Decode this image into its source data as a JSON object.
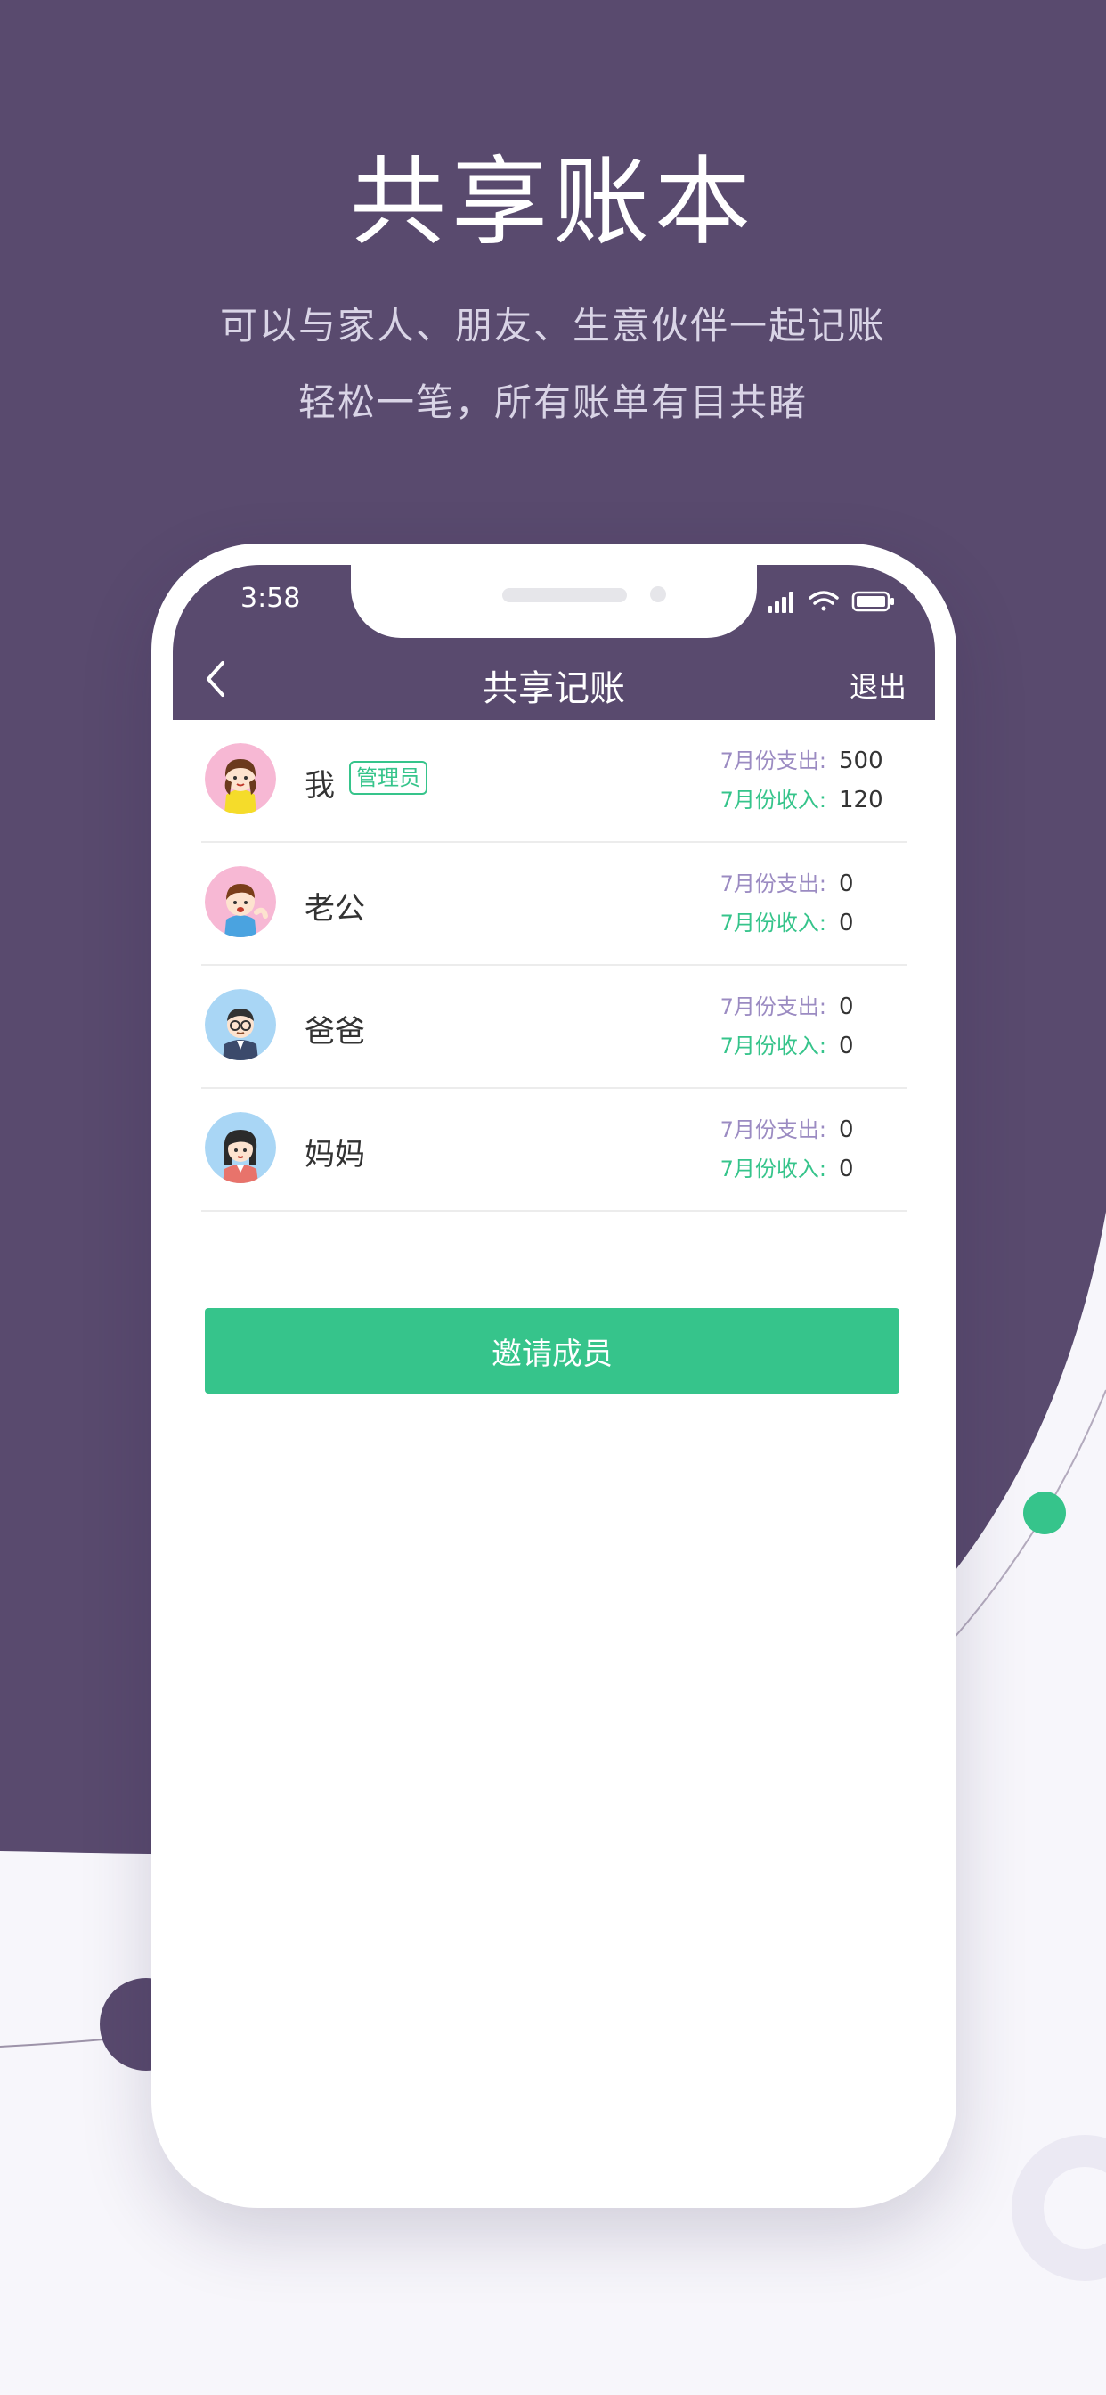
{
  "promo": {
    "headline": "共享账本",
    "subline1": "可以与家人、朋友、生意伙伴一起记账",
    "subline2": "轻松一笔，所有账单有目共睹"
  },
  "status_bar": {
    "time": "3:58",
    "icons": [
      "signal-icon",
      "wifi-icon",
      "battery-icon"
    ]
  },
  "nav": {
    "back_icon": "chevron-left-icon",
    "title": "共享记账",
    "exit_label": "退出"
  },
  "members": [
    {
      "name": "我",
      "badge": "管理员",
      "expense_label": "7月份支出:",
      "expense": "500",
      "income_label": "7月份收入:",
      "income": "120",
      "avatar": "girl-avatar"
    },
    {
      "name": "老公",
      "badge": "",
      "expense_label": "7月份支出:",
      "expense": "0",
      "income_label": "7月份收入:",
      "income": "0",
      "avatar": "boy-avatar"
    },
    {
      "name": "爸爸",
      "badge": "",
      "expense_label": "7月份支出:",
      "expense": "0",
      "income_label": "7月份收入:",
      "income": "0",
      "avatar": "man-glasses-avatar"
    },
    {
      "name": "妈妈",
      "badge": "",
      "expense_label": "7月份支出:",
      "expense": "0",
      "income_label": "7月份收入:",
      "income": "0",
      "avatar": "woman-avatar"
    }
  ],
  "invite_button": "邀请成员",
  "colors": {
    "brand_purple": "#594a6e",
    "accent_green": "#36c48b",
    "expense_label": "#9b8bc2"
  }
}
